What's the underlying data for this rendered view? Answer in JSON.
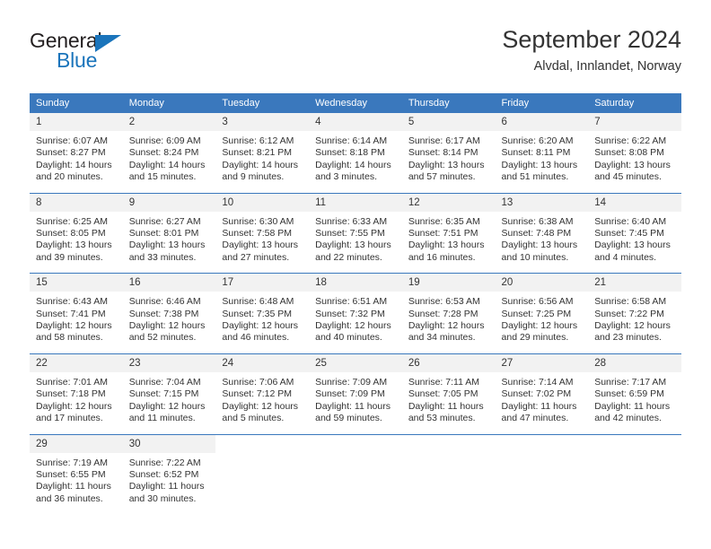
{
  "brand": {
    "line1": "General",
    "line2": "Blue",
    "triangle_color": "#1a74bb",
    "icon": "triangle-logo-icon"
  },
  "header": {
    "title": "September 2024",
    "subtitle": "Alvdal, Innlandet, Norway"
  },
  "theme": {
    "header_blue": "#3a78bd",
    "daynum_bg": "#f2f2f2",
    "text": "#333333"
  },
  "weekday_headers": [
    "Sunday",
    "Monday",
    "Tuesday",
    "Wednesday",
    "Thursday",
    "Friday",
    "Saturday"
  ],
  "weeks": [
    {
      "days": [
        {
          "num": "1",
          "sunrise": "Sunrise: 6:07 AM",
          "sunset": "Sunset: 8:27 PM",
          "daylight1": "Daylight: 14 hours",
          "daylight2": "and 20 minutes."
        },
        {
          "num": "2",
          "sunrise": "Sunrise: 6:09 AM",
          "sunset": "Sunset: 8:24 PM",
          "daylight1": "Daylight: 14 hours",
          "daylight2": "and 15 minutes."
        },
        {
          "num": "3",
          "sunrise": "Sunrise: 6:12 AM",
          "sunset": "Sunset: 8:21 PM",
          "daylight1": "Daylight: 14 hours",
          "daylight2": "and 9 minutes."
        },
        {
          "num": "4",
          "sunrise": "Sunrise: 6:14 AM",
          "sunset": "Sunset: 8:18 PM",
          "daylight1": "Daylight: 14 hours",
          "daylight2": "and 3 minutes."
        },
        {
          "num": "5",
          "sunrise": "Sunrise: 6:17 AM",
          "sunset": "Sunset: 8:14 PM",
          "daylight1": "Daylight: 13 hours",
          "daylight2": "and 57 minutes."
        },
        {
          "num": "6",
          "sunrise": "Sunrise: 6:20 AM",
          "sunset": "Sunset: 8:11 PM",
          "daylight1": "Daylight: 13 hours",
          "daylight2": "and 51 minutes."
        },
        {
          "num": "7",
          "sunrise": "Sunrise: 6:22 AM",
          "sunset": "Sunset: 8:08 PM",
          "daylight1": "Daylight: 13 hours",
          "daylight2": "and 45 minutes."
        }
      ]
    },
    {
      "days": [
        {
          "num": "8",
          "sunrise": "Sunrise: 6:25 AM",
          "sunset": "Sunset: 8:05 PM",
          "daylight1": "Daylight: 13 hours",
          "daylight2": "and 39 minutes."
        },
        {
          "num": "9",
          "sunrise": "Sunrise: 6:27 AM",
          "sunset": "Sunset: 8:01 PM",
          "daylight1": "Daylight: 13 hours",
          "daylight2": "and 33 minutes."
        },
        {
          "num": "10",
          "sunrise": "Sunrise: 6:30 AM",
          "sunset": "Sunset: 7:58 PM",
          "daylight1": "Daylight: 13 hours",
          "daylight2": "and 27 minutes."
        },
        {
          "num": "11",
          "sunrise": "Sunrise: 6:33 AM",
          "sunset": "Sunset: 7:55 PM",
          "daylight1": "Daylight: 13 hours",
          "daylight2": "and 22 minutes."
        },
        {
          "num": "12",
          "sunrise": "Sunrise: 6:35 AM",
          "sunset": "Sunset: 7:51 PM",
          "daylight1": "Daylight: 13 hours",
          "daylight2": "and 16 minutes."
        },
        {
          "num": "13",
          "sunrise": "Sunrise: 6:38 AM",
          "sunset": "Sunset: 7:48 PM",
          "daylight1": "Daylight: 13 hours",
          "daylight2": "and 10 minutes."
        },
        {
          "num": "14",
          "sunrise": "Sunrise: 6:40 AM",
          "sunset": "Sunset: 7:45 PM",
          "daylight1": "Daylight: 13 hours",
          "daylight2": "and 4 minutes."
        }
      ]
    },
    {
      "days": [
        {
          "num": "15",
          "sunrise": "Sunrise: 6:43 AM",
          "sunset": "Sunset: 7:41 PM",
          "daylight1": "Daylight: 12 hours",
          "daylight2": "and 58 minutes."
        },
        {
          "num": "16",
          "sunrise": "Sunrise: 6:46 AM",
          "sunset": "Sunset: 7:38 PM",
          "daylight1": "Daylight: 12 hours",
          "daylight2": "and 52 minutes."
        },
        {
          "num": "17",
          "sunrise": "Sunrise: 6:48 AM",
          "sunset": "Sunset: 7:35 PM",
          "daylight1": "Daylight: 12 hours",
          "daylight2": "and 46 minutes."
        },
        {
          "num": "18",
          "sunrise": "Sunrise: 6:51 AM",
          "sunset": "Sunset: 7:32 PM",
          "daylight1": "Daylight: 12 hours",
          "daylight2": "and 40 minutes."
        },
        {
          "num": "19",
          "sunrise": "Sunrise: 6:53 AM",
          "sunset": "Sunset: 7:28 PM",
          "daylight1": "Daylight: 12 hours",
          "daylight2": "and 34 minutes."
        },
        {
          "num": "20",
          "sunrise": "Sunrise: 6:56 AM",
          "sunset": "Sunset: 7:25 PM",
          "daylight1": "Daylight: 12 hours",
          "daylight2": "and 29 minutes."
        },
        {
          "num": "21",
          "sunrise": "Sunrise: 6:58 AM",
          "sunset": "Sunset: 7:22 PM",
          "daylight1": "Daylight: 12 hours",
          "daylight2": "and 23 minutes."
        }
      ]
    },
    {
      "days": [
        {
          "num": "22",
          "sunrise": "Sunrise: 7:01 AM",
          "sunset": "Sunset: 7:18 PM",
          "daylight1": "Daylight: 12 hours",
          "daylight2": "and 17 minutes."
        },
        {
          "num": "23",
          "sunrise": "Sunrise: 7:04 AM",
          "sunset": "Sunset: 7:15 PM",
          "daylight1": "Daylight: 12 hours",
          "daylight2": "and 11 minutes."
        },
        {
          "num": "24",
          "sunrise": "Sunrise: 7:06 AM",
          "sunset": "Sunset: 7:12 PM",
          "daylight1": "Daylight: 12 hours",
          "daylight2": "and 5 minutes."
        },
        {
          "num": "25",
          "sunrise": "Sunrise: 7:09 AM",
          "sunset": "Sunset: 7:09 PM",
          "daylight1": "Daylight: 11 hours",
          "daylight2": "and 59 minutes."
        },
        {
          "num": "26",
          "sunrise": "Sunrise: 7:11 AM",
          "sunset": "Sunset: 7:05 PM",
          "daylight1": "Daylight: 11 hours",
          "daylight2": "and 53 minutes."
        },
        {
          "num": "27",
          "sunrise": "Sunrise: 7:14 AM",
          "sunset": "Sunset: 7:02 PM",
          "daylight1": "Daylight: 11 hours",
          "daylight2": "and 47 minutes."
        },
        {
          "num": "28",
          "sunrise": "Sunrise: 7:17 AM",
          "sunset": "Sunset: 6:59 PM",
          "daylight1": "Daylight: 11 hours",
          "daylight2": "and 42 minutes."
        }
      ]
    },
    {
      "days": [
        {
          "num": "29",
          "sunrise": "Sunrise: 7:19 AM",
          "sunset": "Sunset: 6:55 PM",
          "daylight1": "Daylight: 11 hours",
          "daylight2": "and 36 minutes."
        },
        {
          "num": "30",
          "sunrise": "Sunrise: 7:22 AM",
          "sunset": "Sunset: 6:52 PM",
          "daylight1": "Daylight: 11 hours",
          "daylight2": "and 30 minutes."
        },
        {
          "num": "",
          "sunrise": "",
          "sunset": "",
          "daylight1": "",
          "daylight2": ""
        },
        {
          "num": "",
          "sunrise": "",
          "sunset": "",
          "daylight1": "",
          "daylight2": ""
        },
        {
          "num": "",
          "sunrise": "",
          "sunset": "",
          "daylight1": "",
          "daylight2": ""
        },
        {
          "num": "",
          "sunrise": "",
          "sunset": "",
          "daylight1": "",
          "daylight2": ""
        },
        {
          "num": "",
          "sunrise": "",
          "sunset": "",
          "daylight1": "",
          "daylight2": ""
        }
      ]
    }
  ]
}
